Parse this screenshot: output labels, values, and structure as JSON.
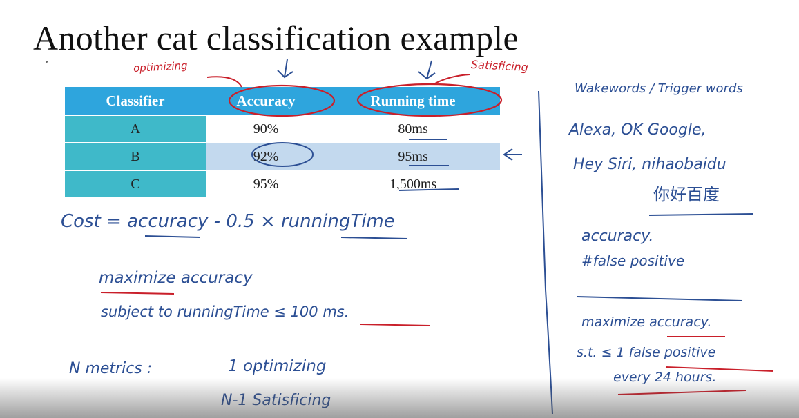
{
  "slide": {
    "title": "Another cat classification example"
  },
  "table": {
    "headers": [
      "Classifier",
      "Accuracy",
      "Running time"
    ],
    "rows": [
      {
        "classifier": "A",
        "accuracy": "90%",
        "running_time": "80ms"
      },
      {
        "classifier": "B",
        "accuracy": "92%",
        "running_time": "95ms"
      },
      {
        "classifier": "C",
        "accuracy": "95%",
        "running_time": "1,500ms"
      }
    ]
  },
  "annotations": {
    "optimizing_label": "optimizing",
    "satisficing_label": "Satisficing",
    "cost_formula": "Cost = accuracy - 0.5 × runningTime",
    "maximize_line": "maximize   accuracy",
    "subject_line": "subject  to     runningTime ≤ 100 ms.",
    "n_metrics": "N  metrics :",
    "one_optimizing": "1  optimizing",
    "n_minus_one": "N-1  Satisficing",
    "wakewords_heading": "Wakewords / Trigger words",
    "wakewords_line1": "Alexa,  OK  Google,",
    "wakewords_line2": "Hey Siri,  nihaobaidu",
    "wakewords_line3": "你好百度",
    "accuracy_note": "accuracy.",
    "false_positive_note": "#false   positive",
    "maximize_right": "maximize   accuracy.",
    "st_line": "s.t.  ≤ 1   false positive",
    "every_line": "every  24 hours."
  },
  "colors": {
    "header_blue": "#2ea5dd",
    "label_teal": "#3fb9c9",
    "highlight_row": "#c3d9ee",
    "ink_blue": "#2c4f94",
    "ink_red": "#c91f2a"
  }
}
